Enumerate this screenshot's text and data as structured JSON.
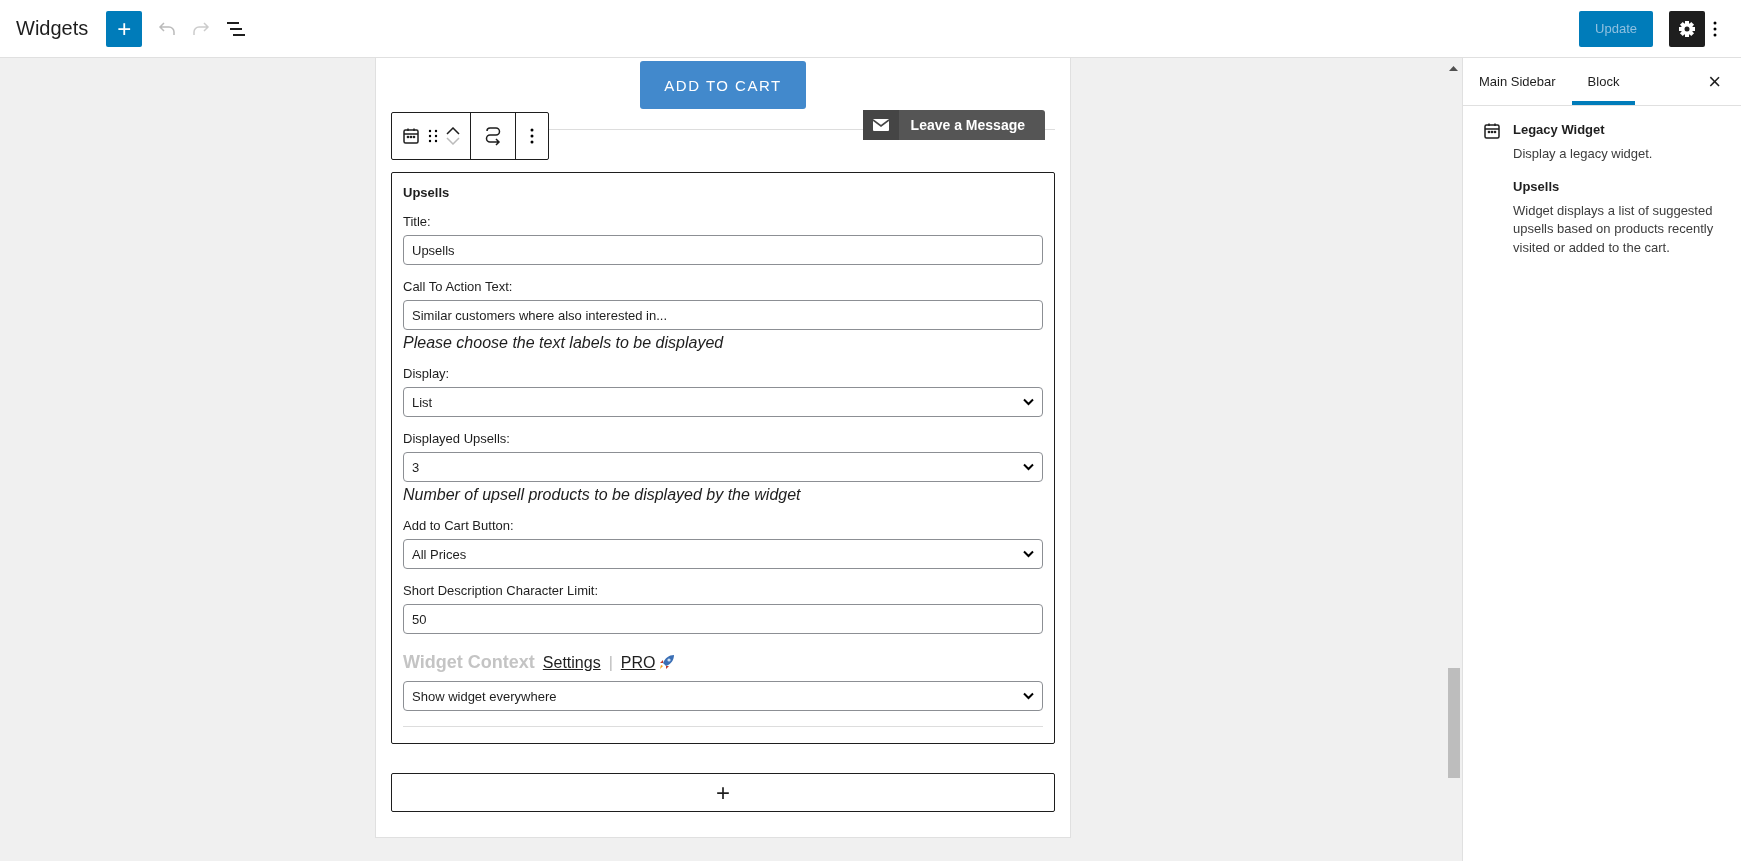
{
  "header": {
    "title": "Widgets",
    "add_label": "+",
    "undo": {
      "disabled": true
    },
    "redo": {
      "disabled": true
    },
    "update": {
      "label": "Update",
      "disabled": true
    },
    "settings": {
      "selected": true
    }
  },
  "canvas": {
    "add_to_cart": "ADD TO CART",
    "message_tab": "Leave a Message",
    "widget": {
      "title": "Upsells",
      "fields": [
        {
          "kind": "text",
          "label": "Title:",
          "value": "Upsells"
        },
        {
          "kind": "text",
          "label": "Call To Action Text:",
          "value": "Similar customers where also interested in...",
          "hint": "Please choose the text labels to be displayed"
        },
        {
          "kind": "select",
          "label": "Display:",
          "value": "List"
        },
        {
          "kind": "select",
          "label": "Displayed Upsells:",
          "value": "3",
          "hint": "Number of upsell products to be displayed by the widget"
        },
        {
          "kind": "select",
          "label": "Add to Cart Button:",
          "value": "All Prices"
        },
        {
          "kind": "text",
          "label": "Short Description Character Limit:",
          "value": "50"
        }
      ],
      "context": {
        "heading": "Widget Context",
        "settings_link": "Settings",
        "separator": "|",
        "pro_link": "PRO",
        "value": "Show widget everywhere"
      }
    },
    "append_label": "+"
  },
  "sidebar": {
    "tabs": [
      {
        "label": "Main Sidebar",
        "selected": false
      },
      {
        "label": "Block",
        "selected": true
      }
    ],
    "close": "×",
    "blocks": [
      {
        "kind": "icon",
        "title": "Legacy Widget",
        "description": "Display a legacy widget."
      },
      {
        "kind": "plain",
        "title": "Upsells",
        "description": "Widget displays a list of suggested upsells based on products recently visited or added to the cart."
      }
    ]
  }
}
